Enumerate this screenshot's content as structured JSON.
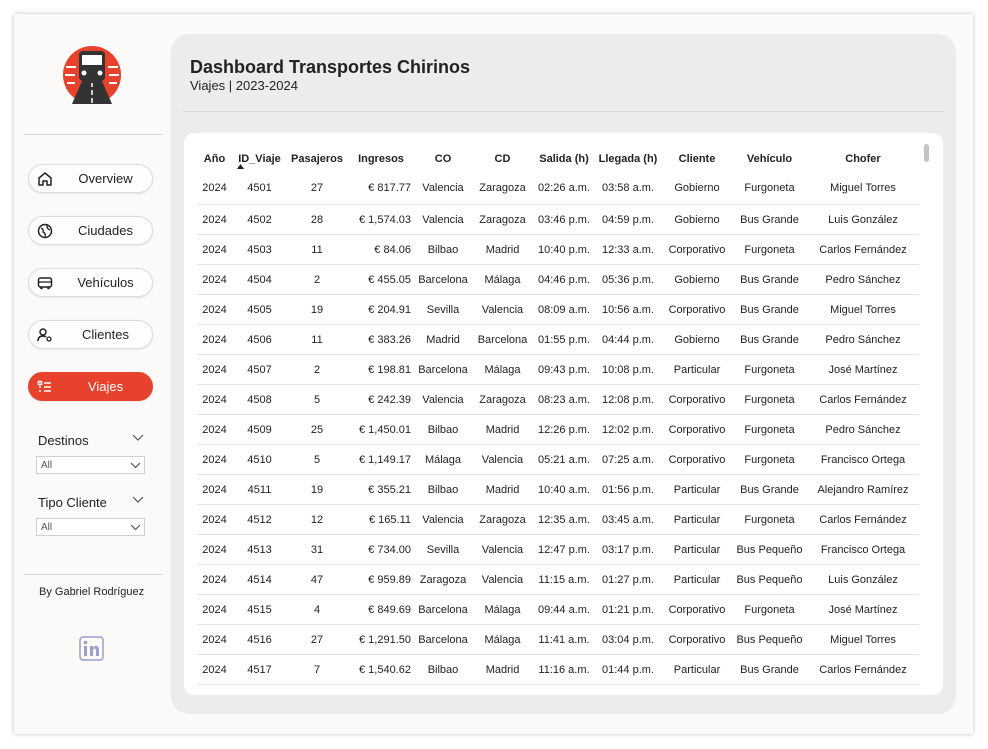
{
  "header": {
    "title": "Dashboard Transportes Chirinos",
    "subtitle": "Viajes | 2023-2024"
  },
  "sidebar": {
    "items": [
      {
        "label": "Overview",
        "icon": "home-icon"
      },
      {
        "label": "Ciudades",
        "icon": "globe-icon"
      },
      {
        "label": "Vehículos",
        "icon": "bus-icon"
      },
      {
        "label": "Clientes",
        "icon": "user-gear-icon"
      },
      {
        "label": "Viajes",
        "icon": "list-icon",
        "active": true
      }
    ],
    "filters": {
      "destinos": {
        "label": "Destinos",
        "value": "All"
      },
      "tipo_cliente": {
        "label": "Tipo Cliente",
        "value": "All"
      }
    },
    "byline": "By Gabriel Rodríguez",
    "accent_color": "#e8412c"
  },
  "table": {
    "columns": [
      "Año",
      "ID_Viaje",
      "Pasajeros",
      "Ingresos",
      "CO",
      "CD",
      "Salida (h)",
      "Llegada (h)",
      "Cliente",
      "Vehículo",
      "Chofer"
    ],
    "sorted_column": "ID_Viaje",
    "rows": [
      [
        "2024",
        "4501",
        "27",
        "€ 817.77",
        "Valencia",
        "Zaragoza",
        "02:26 a.m.",
        "03:58 a.m.",
        "Gobierno",
        "Furgoneta",
        "Miguel Torres"
      ],
      [
        "2024",
        "4502",
        "28",
        "€ 1,574.03",
        "Valencia",
        "Zaragoza",
        "03:46 p.m.",
        "04:59 p.m.",
        "Gobierno",
        "Bus Grande",
        "Luis González"
      ],
      [
        "2024",
        "4503",
        "11",
        "€ 84.06",
        "Bilbao",
        "Madrid",
        "10:40 p.m.",
        "12:33 a.m.",
        "Corporativo",
        "Furgoneta",
        "Carlos Fernández"
      ],
      [
        "2024",
        "4504",
        "2",
        "€ 455.05",
        "Barcelona",
        "Málaga",
        "04:46 p.m.",
        "05:36 p.m.",
        "Gobierno",
        "Bus Grande",
        "Pedro Sánchez"
      ],
      [
        "2024",
        "4505",
        "19",
        "€ 204.91",
        "Sevilla",
        "Valencia",
        "08:09 a.m.",
        "10:56 a.m.",
        "Corporativo",
        "Bus Grande",
        "Miguel Torres"
      ],
      [
        "2024",
        "4506",
        "11",
        "€ 383.26",
        "Madrid",
        "Barcelona",
        "01:55 p.m.",
        "04:44 p.m.",
        "Gobierno",
        "Bus Grande",
        "Pedro Sánchez"
      ],
      [
        "2024",
        "4507",
        "2",
        "€ 198.81",
        "Barcelona",
        "Málaga",
        "09:43 p.m.",
        "10:08 p.m.",
        "Particular",
        "Furgoneta",
        "José Martínez"
      ],
      [
        "2024",
        "4508",
        "5",
        "€ 242.39",
        "Valencia",
        "Zaragoza",
        "08:23 a.m.",
        "12:08 p.m.",
        "Corporativo",
        "Furgoneta",
        "Carlos Fernández"
      ],
      [
        "2024",
        "4509",
        "25",
        "€ 1,450.01",
        "Bilbao",
        "Madrid",
        "12:26 p.m.",
        "12:02 p.m.",
        "Corporativo",
        "Furgoneta",
        "Pedro Sánchez"
      ],
      [
        "2024",
        "4510",
        "5",
        "€ 1,149.17",
        "Málaga",
        "Valencia",
        "05:21 a.m.",
        "07:25 a.m.",
        "Corporativo",
        "Furgoneta",
        "Francisco Ortega"
      ],
      [
        "2024",
        "4511",
        "19",
        "€ 355.21",
        "Bilbao",
        "Madrid",
        "10:40 a.m.",
        "01:56 p.m.",
        "Particular",
        "Bus Grande",
        "Alejandro Ramírez"
      ],
      [
        "2024",
        "4512",
        "12",
        "€ 165.11",
        "Valencia",
        "Zaragoza",
        "12:35 a.m.",
        "03:45 a.m.",
        "Particular",
        "Furgoneta",
        "Carlos Fernández"
      ],
      [
        "2024",
        "4513",
        "31",
        "€ 734.00",
        "Sevilla",
        "Valencia",
        "12:47 p.m.",
        "03:17 p.m.",
        "Particular",
        "Bus Pequeño",
        "Francisco Ortega"
      ],
      [
        "2024",
        "4514",
        "47",
        "€ 959.89",
        "Zaragoza",
        "Valencia",
        "11:15 a.m.",
        "01:27 p.m.",
        "Particular",
        "Bus Pequeño",
        "Luis González"
      ],
      [
        "2024",
        "4515",
        "4",
        "€ 849.69",
        "Barcelona",
        "Málaga",
        "09:44 a.m.",
        "01:21 p.m.",
        "Corporativo",
        "Furgoneta",
        "José Martínez"
      ],
      [
        "2024",
        "4516",
        "27",
        "€ 1,291.50",
        "Barcelona",
        "Málaga",
        "11:41 a.m.",
        "03:04 p.m.",
        "Corporativo",
        "Bus Pequeño",
        "Miguel Torres"
      ],
      [
        "2024",
        "4517",
        "7",
        "€ 1,540.62",
        "Bilbao",
        "Madrid",
        "11:16 a.m.",
        "01:44 p.m.",
        "Particular",
        "Bus Grande",
        "Carlos Fernández"
      ]
    ]
  }
}
